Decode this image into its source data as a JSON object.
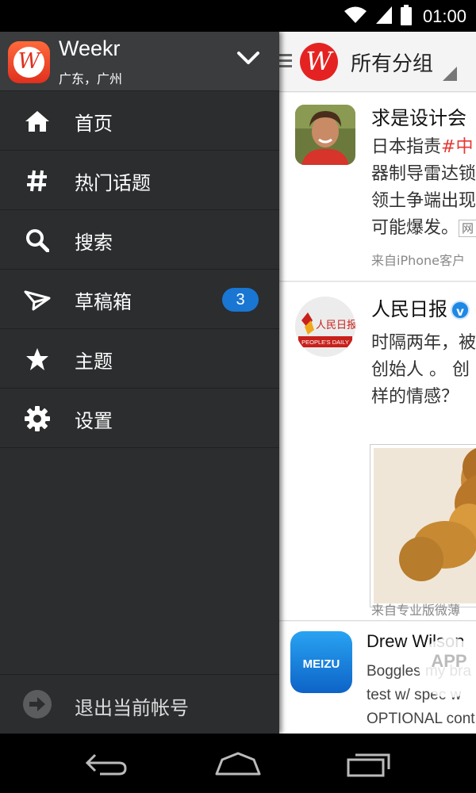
{
  "status_bar": {
    "time": "01:00"
  },
  "drawer": {
    "app_name": "Weekr",
    "location": "广东，广州",
    "items": [
      {
        "label": "首页",
        "icon": "home-icon"
      },
      {
        "label": "热门话题",
        "icon": "hash-icon"
      },
      {
        "label": "搜索",
        "icon": "search-icon"
      },
      {
        "label": "草稿箱",
        "icon": "paper-plane-icon",
        "badge": "3"
      },
      {
        "label": "主题",
        "icon": "star-icon"
      },
      {
        "label": "设置",
        "icon": "gear-icon"
      }
    ],
    "logout_label": "退出当前帐号"
  },
  "feed": {
    "group_label": "所有分组",
    "posts": [
      {
        "name": "求是设计会",
        "lines": [
          "日本指责",
          "#中",
          "器制导雷达锁",
          "领土争端出现",
          "可能爆发。",
          "网"
        ],
        "source": "来自iPhone客户"
      },
      {
        "name": "人民日报",
        "lines": [
          "时隔两年，被",
          "创始人 。 创",
          "样的情感？"
        ],
        "source": "来自专业版微薄",
        "avatar_text": "人民日报",
        "avatar_subtext": "PEOPLE'S DAILY"
      },
      {
        "name": "Drew Wilson",
        "lines": [
          "Boggles my bra",
          "test w/ spec w",
          "OPTIONAL cont"
        ],
        "avatar_text": "MEIZU"
      }
    ]
  },
  "watermark": "APP",
  "colors": {
    "accent": "#1976d2",
    "brand_red": "#e52222",
    "drawer_bg": "#2b2d2f"
  }
}
